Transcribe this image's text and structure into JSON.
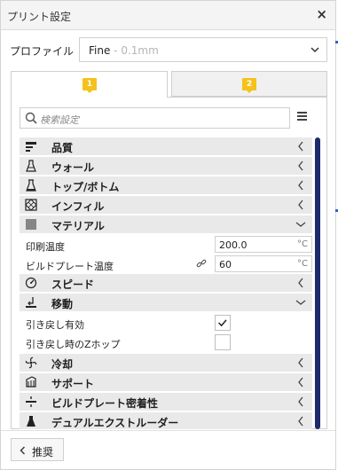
{
  "window": {
    "title": "プリント設定",
    "close_label": "×"
  },
  "profile": {
    "label": "プロファイル",
    "value": "Fine",
    "sub": " - 0.1mm"
  },
  "tabs": [
    {
      "badge": "1"
    },
    {
      "badge": "2"
    }
  ],
  "search": {
    "placeholder": "検索設定"
  },
  "colors": {
    "accent_badge": "#f4c21b",
    "scrollbar": "#1f2a6b",
    "category_bg": "#e9e9e9"
  },
  "categories": {
    "quality": {
      "label": "品質",
      "icon": "quality-icon"
    },
    "wall": {
      "label": "ウォール",
      "icon": "wall-icon"
    },
    "topbottom": {
      "label": "トップ/ボトム",
      "icon": "top-bottom-icon"
    },
    "infill": {
      "label": "インフィル",
      "icon": "infill-icon"
    },
    "material": {
      "label": "マテリアル",
      "icon": "material-icon"
    },
    "speed": {
      "label": "スピード",
      "icon": "speed-icon"
    },
    "travel": {
      "label": "移動",
      "icon": "travel-icon"
    },
    "cooling": {
      "label": "冷却",
      "icon": "cooling-icon"
    },
    "support": {
      "label": "サポート",
      "icon": "support-icon"
    },
    "adhesion": {
      "label": "ビルドプレート密着性",
      "icon": "adhesion-icon"
    },
    "dual": {
      "label": "デュアルエクストルーダー",
      "icon": "dual-extruder-icon"
    }
  },
  "settings": {
    "print_temp": {
      "label": "印刷温度",
      "value": "200.0",
      "unit": "°C"
    },
    "bed_temp": {
      "label": "ビルドプレート温度",
      "value": "60",
      "unit": "°C"
    },
    "retraction": {
      "label": "引き戻し有効",
      "checked": true
    },
    "zhop": {
      "label": "引き戻し時のZホップ",
      "checked": false
    }
  },
  "footer": {
    "recommend_label": "推奨"
  }
}
